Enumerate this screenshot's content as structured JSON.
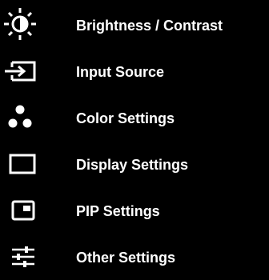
{
  "menu": {
    "items": [
      {
        "label": "Brightness / Contrast",
        "icon": "brightness-contrast-icon"
      },
      {
        "label": "Input Source",
        "icon": "input-source-icon"
      },
      {
        "label": "Color Settings",
        "icon": "color-dots-icon"
      },
      {
        "label": "Display Settings",
        "icon": "display-rectangle-icon"
      },
      {
        "label": "PIP Settings",
        "icon": "picture-in-picture-icon"
      },
      {
        "label": "Other Settings",
        "icon": "sliders-icon"
      }
    ]
  },
  "colors": {
    "background": "#000000",
    "foreground": "#ffffff"
  }
}
